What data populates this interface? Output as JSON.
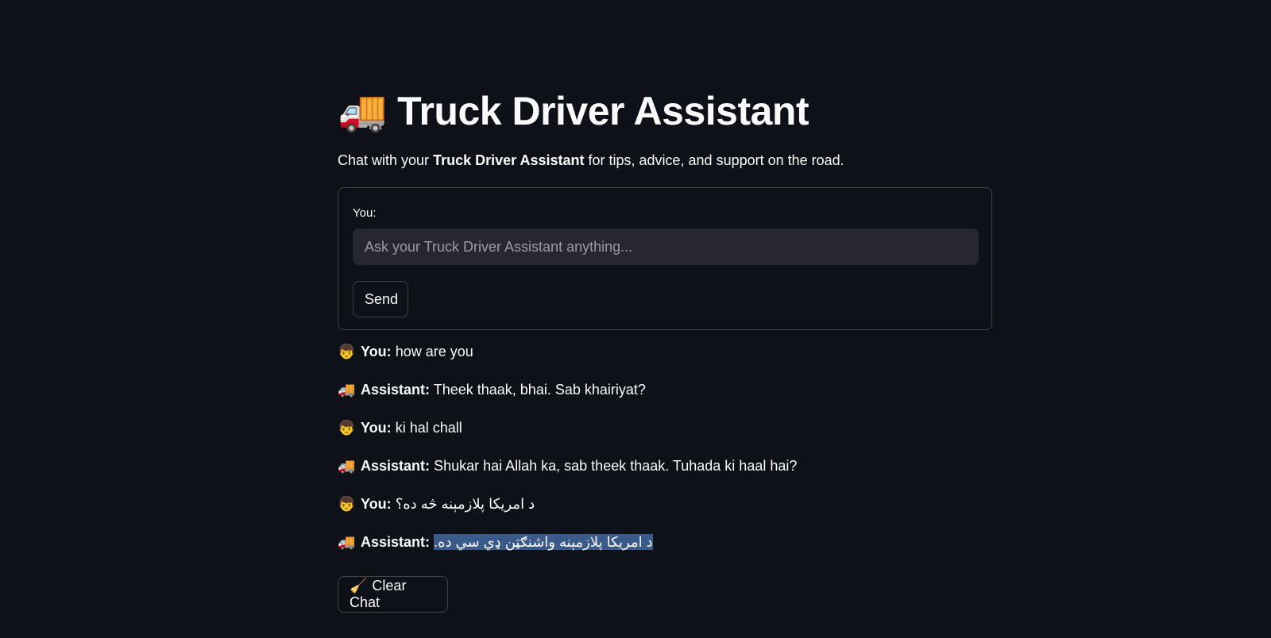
{
  "header": {
    "title_icon": "🚚",
    "title": "Truck Driver Assistant",
    "subtitle_prefix": "Chat with your ",
    "subtitle_bold": "Truck Driver Assistant",
    "subtitle_suffix": " for tips, advice, and support on the road."
  },
  "form": {
    "input_label": "You:",
    "input_placeholder": "Ask your Truck Driver Assistant anything...",
    "input_value": "",
    "send_label": "Send"
  },
  "chat": {
    "user_icon": "👦",
    "assistant_icon": "🚚",
    "messages": [
      {
        "speaker": "You:",
        "text": "how are you"
      },
      {
        "speaker": "Assistant:",
        "text": "Theek thaak, bhai. Sab khairiyat?"
      },
      {
        "speaker": "You:",
        "text": "ki hal chall"
      },
      {
        "speaker": "Assistant:",
        "text": "Shukar hai Allah ka, sab theek thaak. Tuhada ki haal hai?"
      },
      {
        "speaker": "You:",
        "text": "د امریکا پلازمېنه څه ده؟"
      },
      {
        "speaker": "Assistant:",
        "text": "د امریکا پلازمېنه واشنګټن ډي سي ده."
      }
    ]
  },
  "clear_button": {
    "icon": "🧹",
    "label": "Clear Chat"
  }
}
